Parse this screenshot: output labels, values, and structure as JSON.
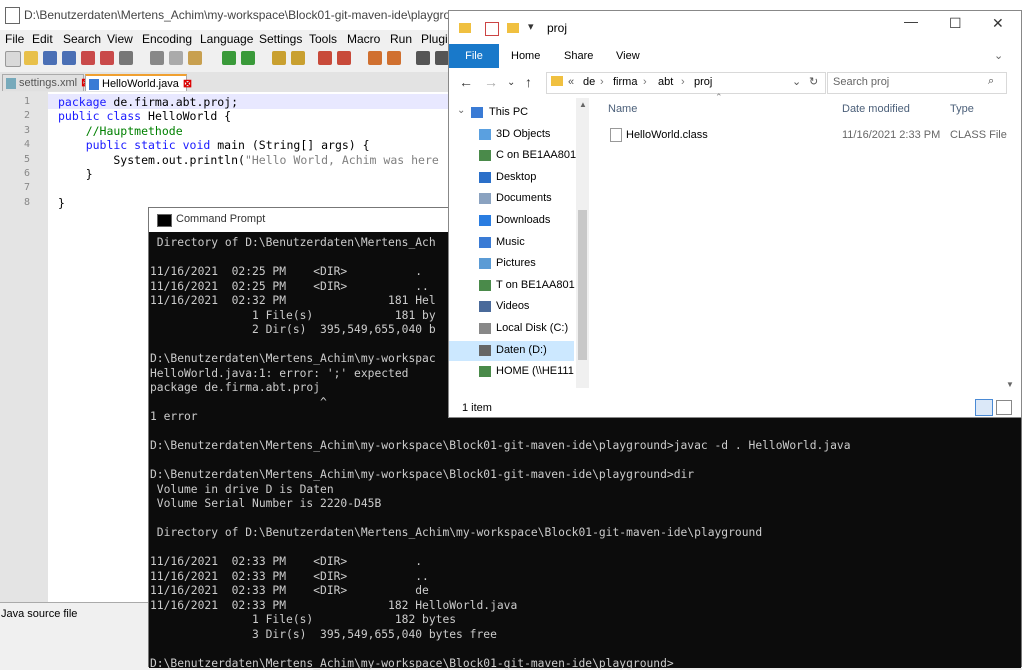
{
  "npp": {
    "title": "D:\\Benutzerdaten\\Mertens_Achim\\my-workspace\\Block01-git-maven-ide\\playground\\HelloWorld.java - Notepad++",
    "menu": [
      "File",
      "Edit",
      "Search",
      "View",
      "Encoding",
      "Language",
      "Settings",
      "Tools",
      "Macro",
      "Run",
      "Plugi"
    ],
    "tabs": [
      {
        "label": "settings.xml"
      },
      {
        "label": "HelloWorld.java"
      }
    ],
    "line_numbers": [
      "1",
      "2",
      "3",
      "4",
      "5",
      "6",
      "7",
      "8"
    ],
    "code": {
      "l1_kw": "package",
      "l1_rest": " de.firma.abt.proj;",
      "l2_kw": "public class",
      "l2_rest": " HelloWorld {",
      "l3": "    //Hauptmethode",
      "l4_kw": "    public static void",
      "l4_rest": " main (String[] args) {",
      "l5_a": "        System.out.println(",
      "l5_str": "\"Hello World, Achim was here",
      "l6": "    }",
      "l8": "}"
    },
    "status": "Java source file"
  },
  "explorer": {
    "title": "proj",
    "ribbon": [
      "File",
      "Home",
      "Share",
      "View"
    ],
    "breadcrumb": [
      "«",
      "de",
      "firma",
      "abt",
      "proj"
    ],
    "search_placeholder": "Search proj",
    "nav": [
      {
        "label": "This PC",
        "icon": "pc-icon",
        "color": "#3a7bd5"
      },
      {
        "label": "3D Objects",
        "icon": "cube-icon",
        "color": "#5aa0e0"
      },
      {
        "label": "C on BE1AA801",
        "icon": "network-drive-icon",
        "color": "#4a8a4a"
      },
      {
        "label": "Desktop",
        "icon": "desktop-icon",
        "color": "#2a6fc9"
      },
      {
        "label": "Documents",
        "icon": "documents-icon",
        "color": "#8aa2c0"
      },
      {
        "label": "Downloads",
        "icon": "download-icon",
        "color": "#2a7de1"
      },
      {
        "label": "Music",
        "icon": "music-icon",
        "color": "#3a7bd5"
      },
      {
        "label": "Pictures",
        "icon": "pictures-icon",
        "color": "#5b9bd5"
      },
      {
        "label": "T on BE1AA801",
        "icon": "network-drive-icon",
        "color": "#4a8a4a"
      },
      {
        "label": "Videos",
        "icon": "videos-icon",
        "color": "#4a6a9a"
      },
      {
        "label": "Local Disk (C:)",
        "icon": "disk-icon",
        "color": "#888888"
      },
      {
        "label": "Daten (D:)",
        "icon": "disk-icon",
        "color": "#666666"
      },
      {
        "label": "HOME (\\\\HE111",
        "icon": "network-drive-icon",
        "color": "#4a8a4a"
      }
    ],
    "columns": [
      "Name",
      "Date modified",
      "Type"
    ],
    "files": [
      {
        "name": "HelloWorld.class",
        "date": "11/16/2021 2:33 PM",
        "type": "CLASS File"
      }
    ],
    "status": "1 item"
  },
  "cmd": {
    "title": "Command Prompt",
    "lines": [
      " Directory of D:\\Benutzerdaten\\Mertens_Ach",
      "",
      "11/16/2021  02:25 PM    <DIR>          .",
      "11/16/2021  02:25 PM    <DIR>          ..",
      "11/16/2021  02:32 PM               181 Hel",
      "               1 File(s)            181 by",
      "               2 Dir(s)  395,549,655,040 b",
      "",
      "D:\\Benutzerdaten\\Mertens_Achim\\my-workspac",
      "HelloWorld.java:1: error: ';' expected",
      "package de.firma.abt.proj",
      "                         ^",
      "1 error",
      "",
      "D:\\Benutzerdaten\\Mertens_Achim\\my-workspace\\Block01-git-maven-ide\\playground>javac -d . HelloWorld.java",
      "",
      "D:\\Benutzerdaten\\Mertens_Achim\\my-workspace\\Block01-git-maven-ide\\playground>dir",
      " Volume in drive D is Daten",
      " Volume Serial Number is 2220-D45B",
      "",
      " Directory of D:\\Benutzerdaten\\Mertens_Achim\\my-workspace\\Block01-git-maven-ide\\playground",
      "",
      "11/16/2021  02:33 PM    <DIR>          .",
      "11/16/2021  02:33 PM    <DIR>          ..",
      "11/16/2021  02:33 PM    <DIR>          de",
      "11/16/2021  02:33 PM               182 HelloWorld.java",
      "               1 File(s)            182 bytes",
      "               3 Dir(s)  395,549,655,040 bytes free",
      "",
      "D:\\Benutzerdaten\\Mertens_Achim\\my-workspace\\Block01-git-maven-ide\\playground>"
    ]
  }
}
